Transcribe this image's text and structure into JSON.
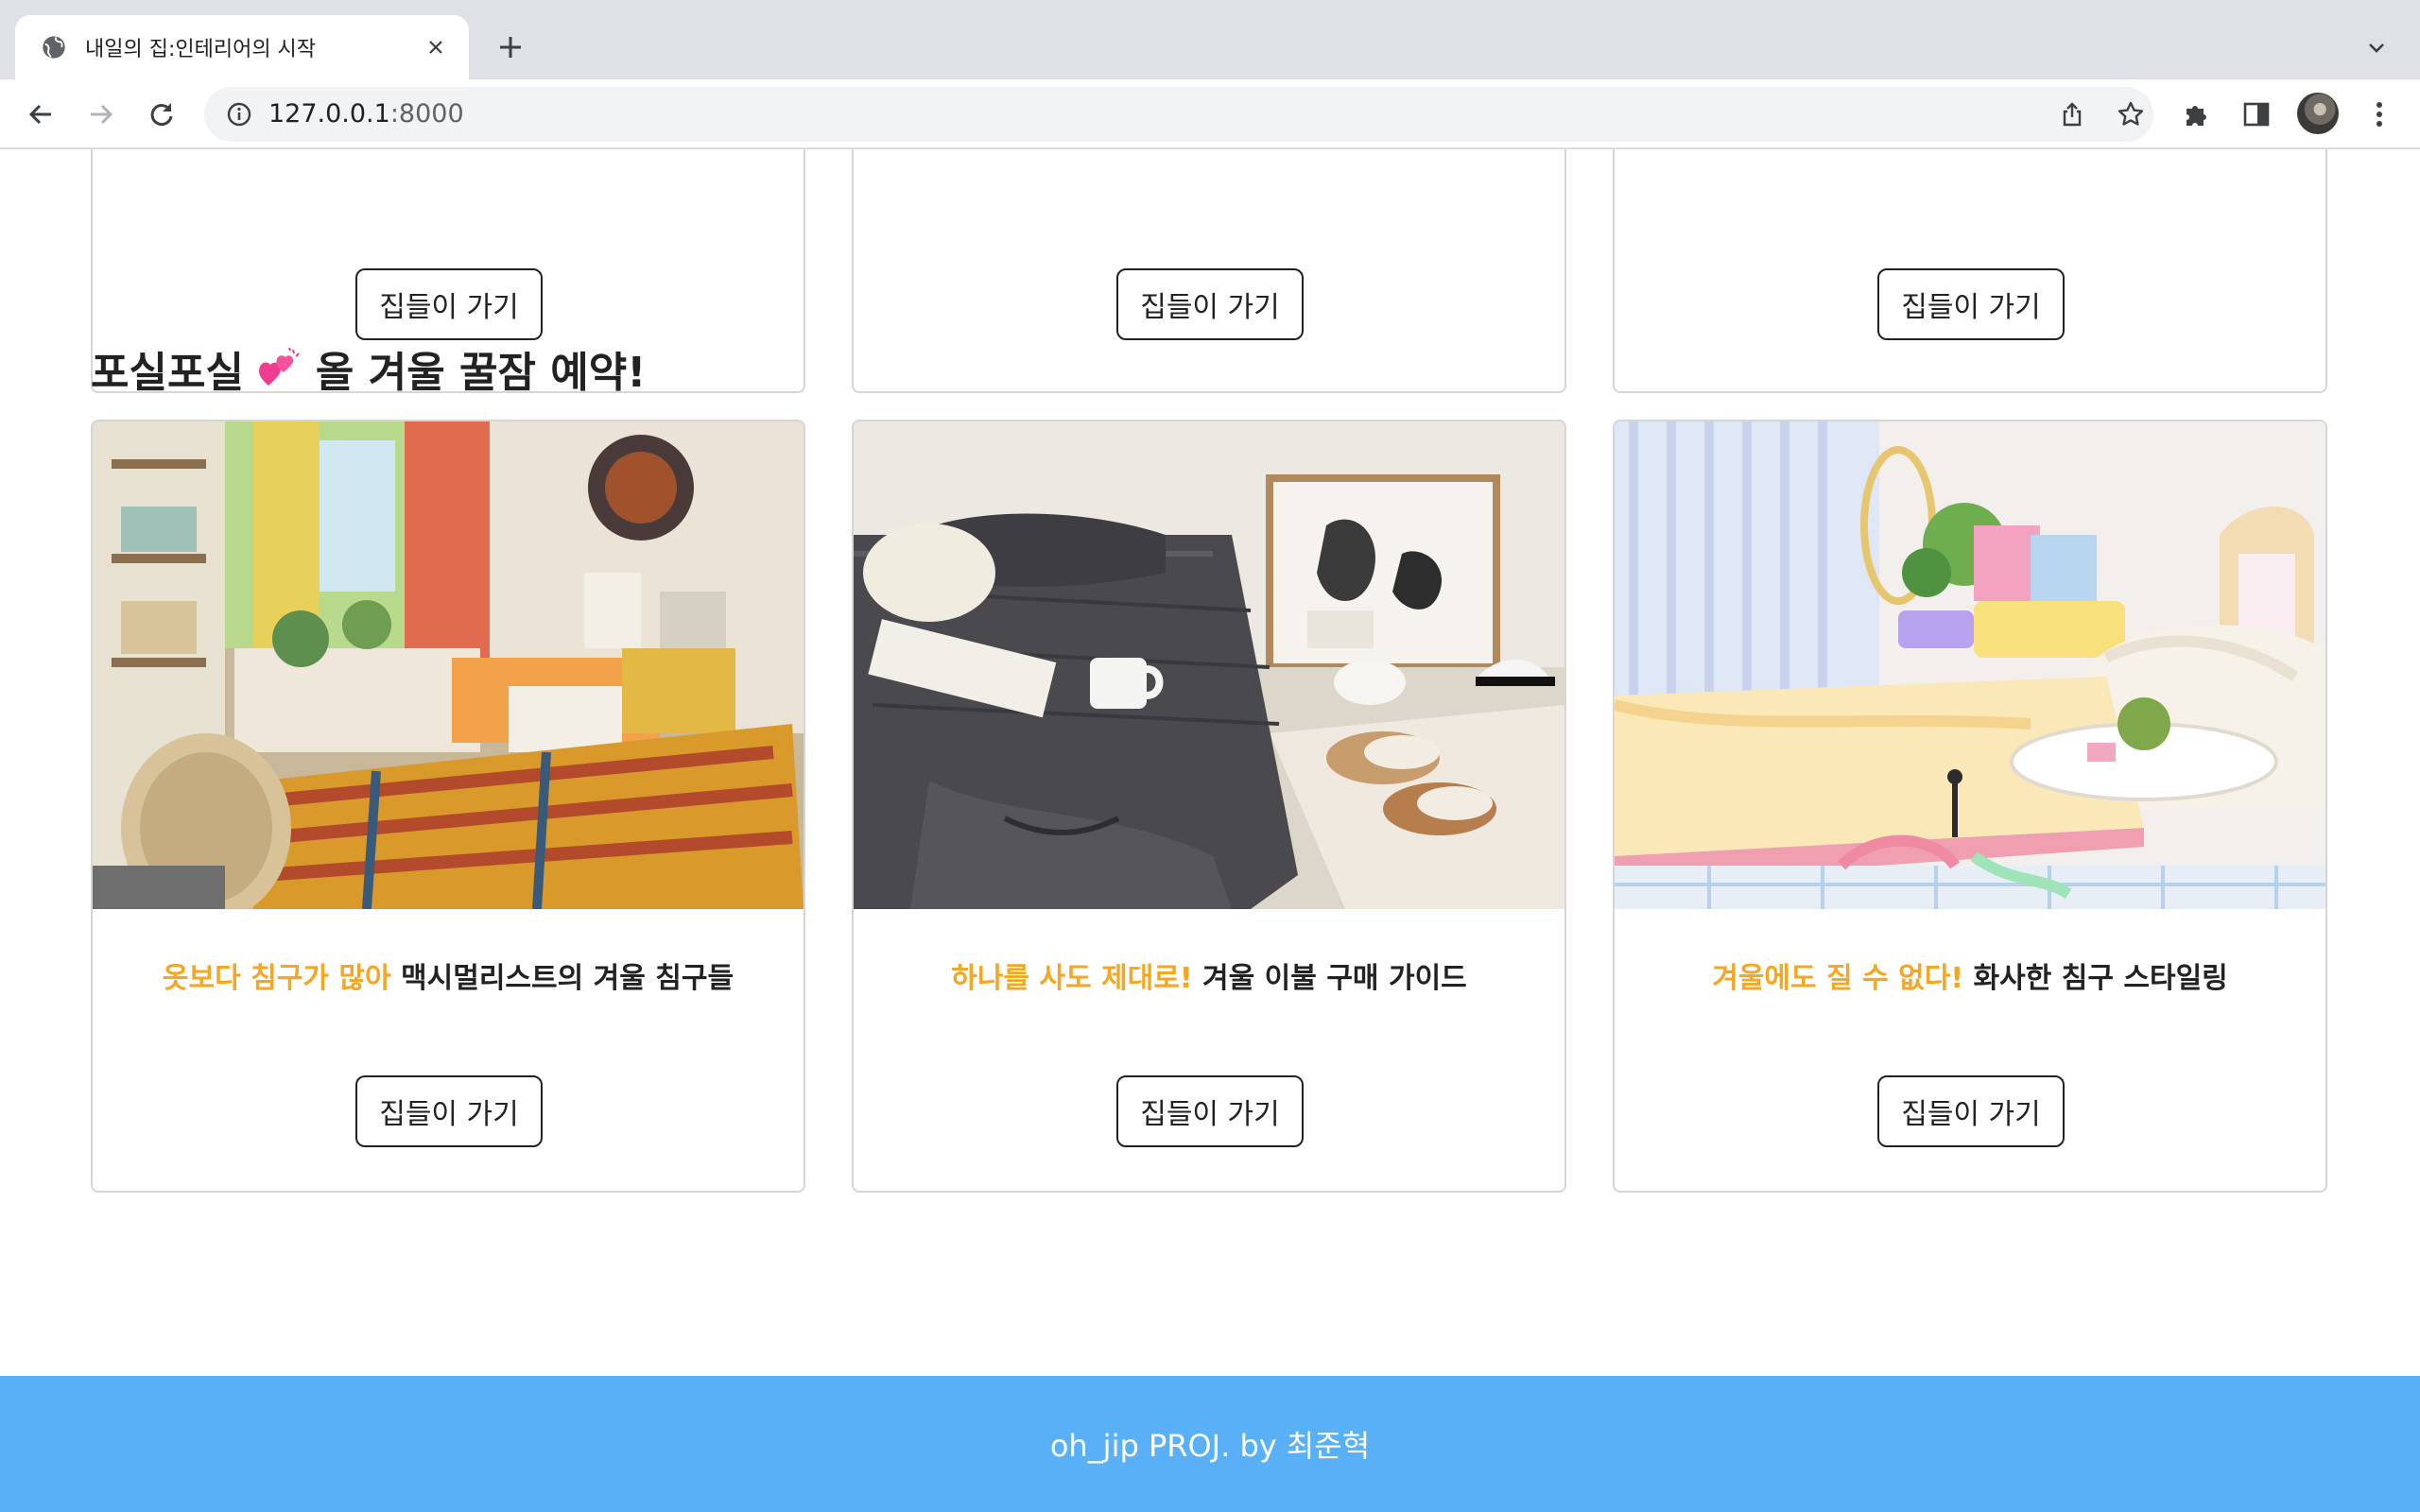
{
  "browser": {
    "tab_title": "내일의 집:인테리어의 시작",
    "url_host": "127.0.0.1",
    "url_port": ":8000"
  },
  "previous_cards": [
    {
      "button_label": "집들이 가기"
    },
    {
      "button_label": "집들이 가기"
    },
    {
      "button_label": "집들이 가기"
    }
  ],
  "section": {
    "title_before": "포실포실",
    "title_emoji": "💕",
    "title_after": "올 겨울 꿀잠 예약!"
  },
  "cards": [
    {
      "highlight": "옷보다 침구가 많아",
      "text": " 맥시멀리스트의 겨울 침구들",
      "button_label": "집들이 가기",
      "image": "maximalist-bedroom"
    },
    {
      "highlight": "하나를 사도 제대로!",
      "text": " 겨울 이불 구매 가이드",
      "button_label": "집들이 가기",
      "image": "gray-duvet-bedroom"
    },
    {
      "highlight": "겨울에도 질 수 없다!",
      "text": " 화사한 침구 스타일링",
      "button_label": "집들이 가기",
      "image": "pastel-bedroom"
    }
  ],
  "footer": {
    "text": "oh_jip PROJ. by 최준혁"
  },
  "colors": {
    "highlight": "#f5a623",
    "footer_bg": "#5ab0f7"
  }
}
